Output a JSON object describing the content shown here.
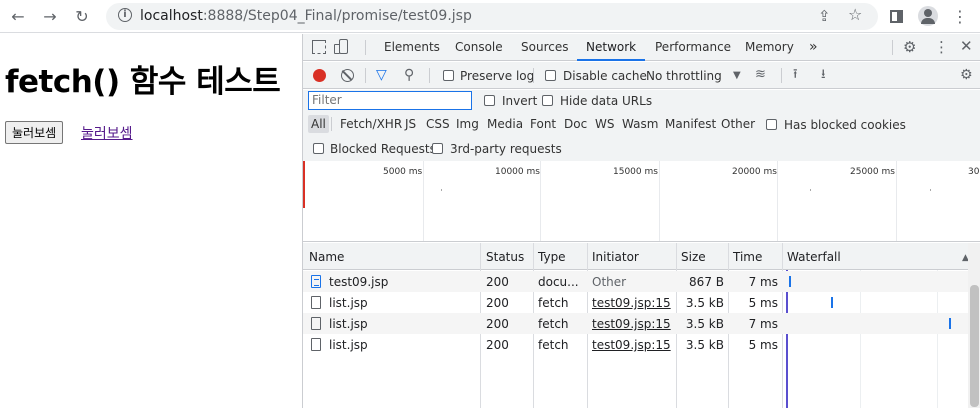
{
  "browser": {
    "url_host": "localhost",
    "url_rest": ":8888/Step04_Final/promise/test09.jsp"
  },
  "page": {
    "heading": "fetch() 함수 테스트",
    "button_label": "눌러보셈",
    "link_label": "눌러보셈"
  },
  "devtools": {
    "tabs": [
      "Elements",
      "Console",
      "Sources",
      "Network",
      "Performance",
      "Memory"
    ],
    "active_tab": "Network",
    "more_tabs": "»",
    "toolbar": {
      "preserve_log": "Preserve log",
      "disable_cache": "Disable cache",
      "throttling": "No throttling"
    },
    "filter": {
      "placeholder": "Filter",
      "invert": "Invert",
      "hide_data_urls": "Hide data URLs"
    },
    "types": [
      "All",
      "Fetch/XHR",
      "JS",
      "CSS",
      "Img",
      "Media",
      "Font",
      "Doc",
      "WS",
      "Wasm",
      "Manifest",
      "Other"
    ],
    "has_blocked_cookies": "Has blocked cookies",
    "blocked_requests": "Blocked Requests",
    "third_party": "3rd-party requests",
    "overview_ticks": [
      "5000 ms",
      "10000 ms",
      "15000 ms",
      "20000 ms",
      "25000 ms",
      "30"
    ],
    "columns": [
      "Name",
      "Status",
      "Type",
      "Initiator",
      "Size",
      "Time",
      "Waterfall"
    ],
    "rows": [
      {
        "name": "test09.jsp",
        "status": "200",
        "type": "docu...",
        "initiator": "Other",
        "size": "867 B",
        "time": "7 ms"
      },
      {
        "name": "list.jsp",
        "status": "200",
        "type": "fetch",
        "initiator": "test09.jsp:15",
        "size": "3.5 kB",
        "time": "5 ms"
      },
      {
        "name": "list.jsp",
        "status": "200",
        "type": "fetch",
        "initiator": "test09.jsp:15",
        "size": "3.5 kB",
        "time": "7 ms"
      },
      {
        "name": "list.jsp",
        "status": "200",
        "type": "fetch",
        "initiator": "test09.jsp:15",
        "size": "3.5 kB",
        "time": "5 ms"
      }
    ],
    "colors": {
      "accent": "#1a73e8",
      "record": "#d93025"
    }
  }
}
